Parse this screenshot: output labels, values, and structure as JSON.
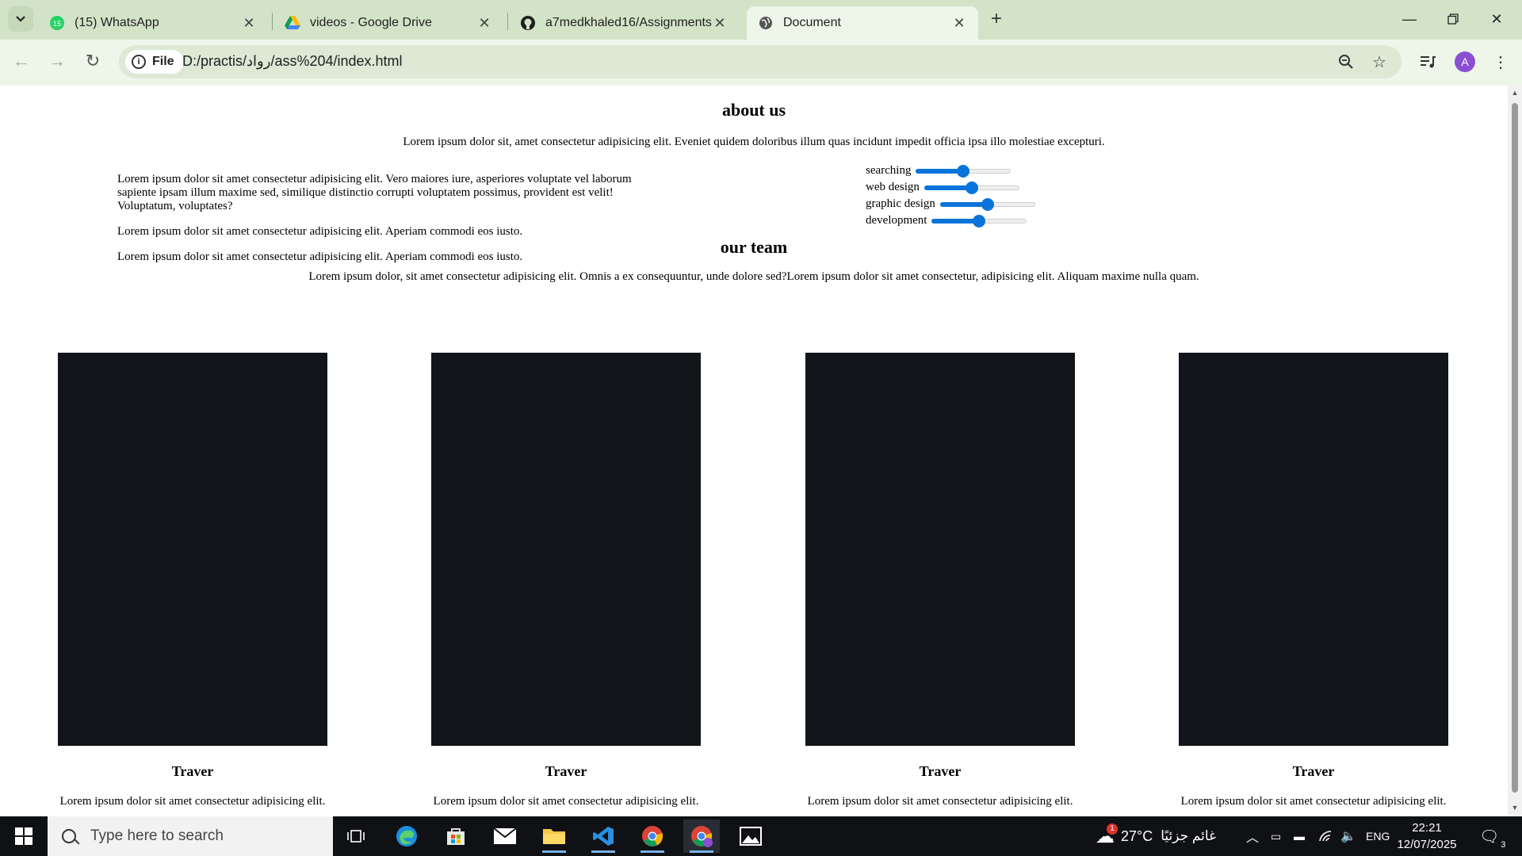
{
  "browser": {
    "tabs": [
      {
        "title": "(15) WhatsApp",
        "badge": "15",
        "favicon": "whatsapp-icon",
        "active": false
      },
      {
        "title": "videos - Google Drive",
        "favicon": "google-drive-icon",
        "active": false
      },
      {
        "title": "a7medkhaled16/Assignments",
        "favicon": "github-icon",
        "active": false
      },
      {
        "title": "Document",
        "favicon": "globe-icon",
        "active": true
      }
    ],
    "chip_label": "File",
    "url": "D:/practis/رواد/ass%204/index.html",
    "profile_initial": "A"
  },
  "page": {
    "about": {
      "heading": "about us",
      "intro": "Lorem ipsum dolor sit, amet consectetur adipisicing elit. Eveniet quidem doloribus illum quas incidunt impedit officia ipsa illo molestiae excepturi.",
      "paragraphs": [
        "Lorem ipsum dolor sit amet consectetur adipisicing elit. Vero maiores iure, asperiores voluptate vel laborum sapiente ipsam illum maxime sed, similique distinctio corrupti voluptatem possimus, provident est velit! Voluptatum, voluptates?",
        "Lorem ipsum dolor sit amet consectetur adipisicing elit. Aperiam commodi eos iusto.",
        "Lorem ipsum dolor sit amet consectetur adipisicing elit. Aperiam commodi eos iusto."
      ],
      "skills": [
        {
          "label": "searching",
          "value": 0.5
        },
        {
          "label": "web design",
          "value": 0.5
        },
        {
          "label": "graphic design",
          "value": 0.5
        },
        {
          "label": "development",
          "value": 0.5
        }
      ]
    },
    "team": {
      "heading": "our team",
      "intro": "Lorem ipsum dolor, sit amet consectetur adipisicing elit. Omnis a ex consequuntur, unde dolore sed?Lorem ipsum dolor sit amet consectetur, adipisicing elit. Aliquam maxime nulla quam.",
      "members": [
        {
          "name": "Traver",
          "desc": "Lorem ipsum dolor sit amet consectetur adipisicing elit."
        },
        {
          "name": "Traver",
          "desc": "Lorem ipsum dolor sit amet consectetur adipisicing elit."
        },
        {
          "name": "Traver",
          "desc": "Lorem ipsum dolor sit amet consectetur adipisicing elit."
        },
        {
          "name": "Traver",
          "desc": "Lorem ipsum dolor sit amet consectetur adipisicing elit."
        }
      ]
    }
  },
  "taskbar": {
    "search_placeholder": "Type here to search",
    "weather": "27°C",
    "weather_desc": "غائم جزئيًا",
    "weather_badge": "1",
    "language": "ENG",
    "time": "22:21",
    "date": "12/07/2025",
    "notifications": "3"
  }
}
